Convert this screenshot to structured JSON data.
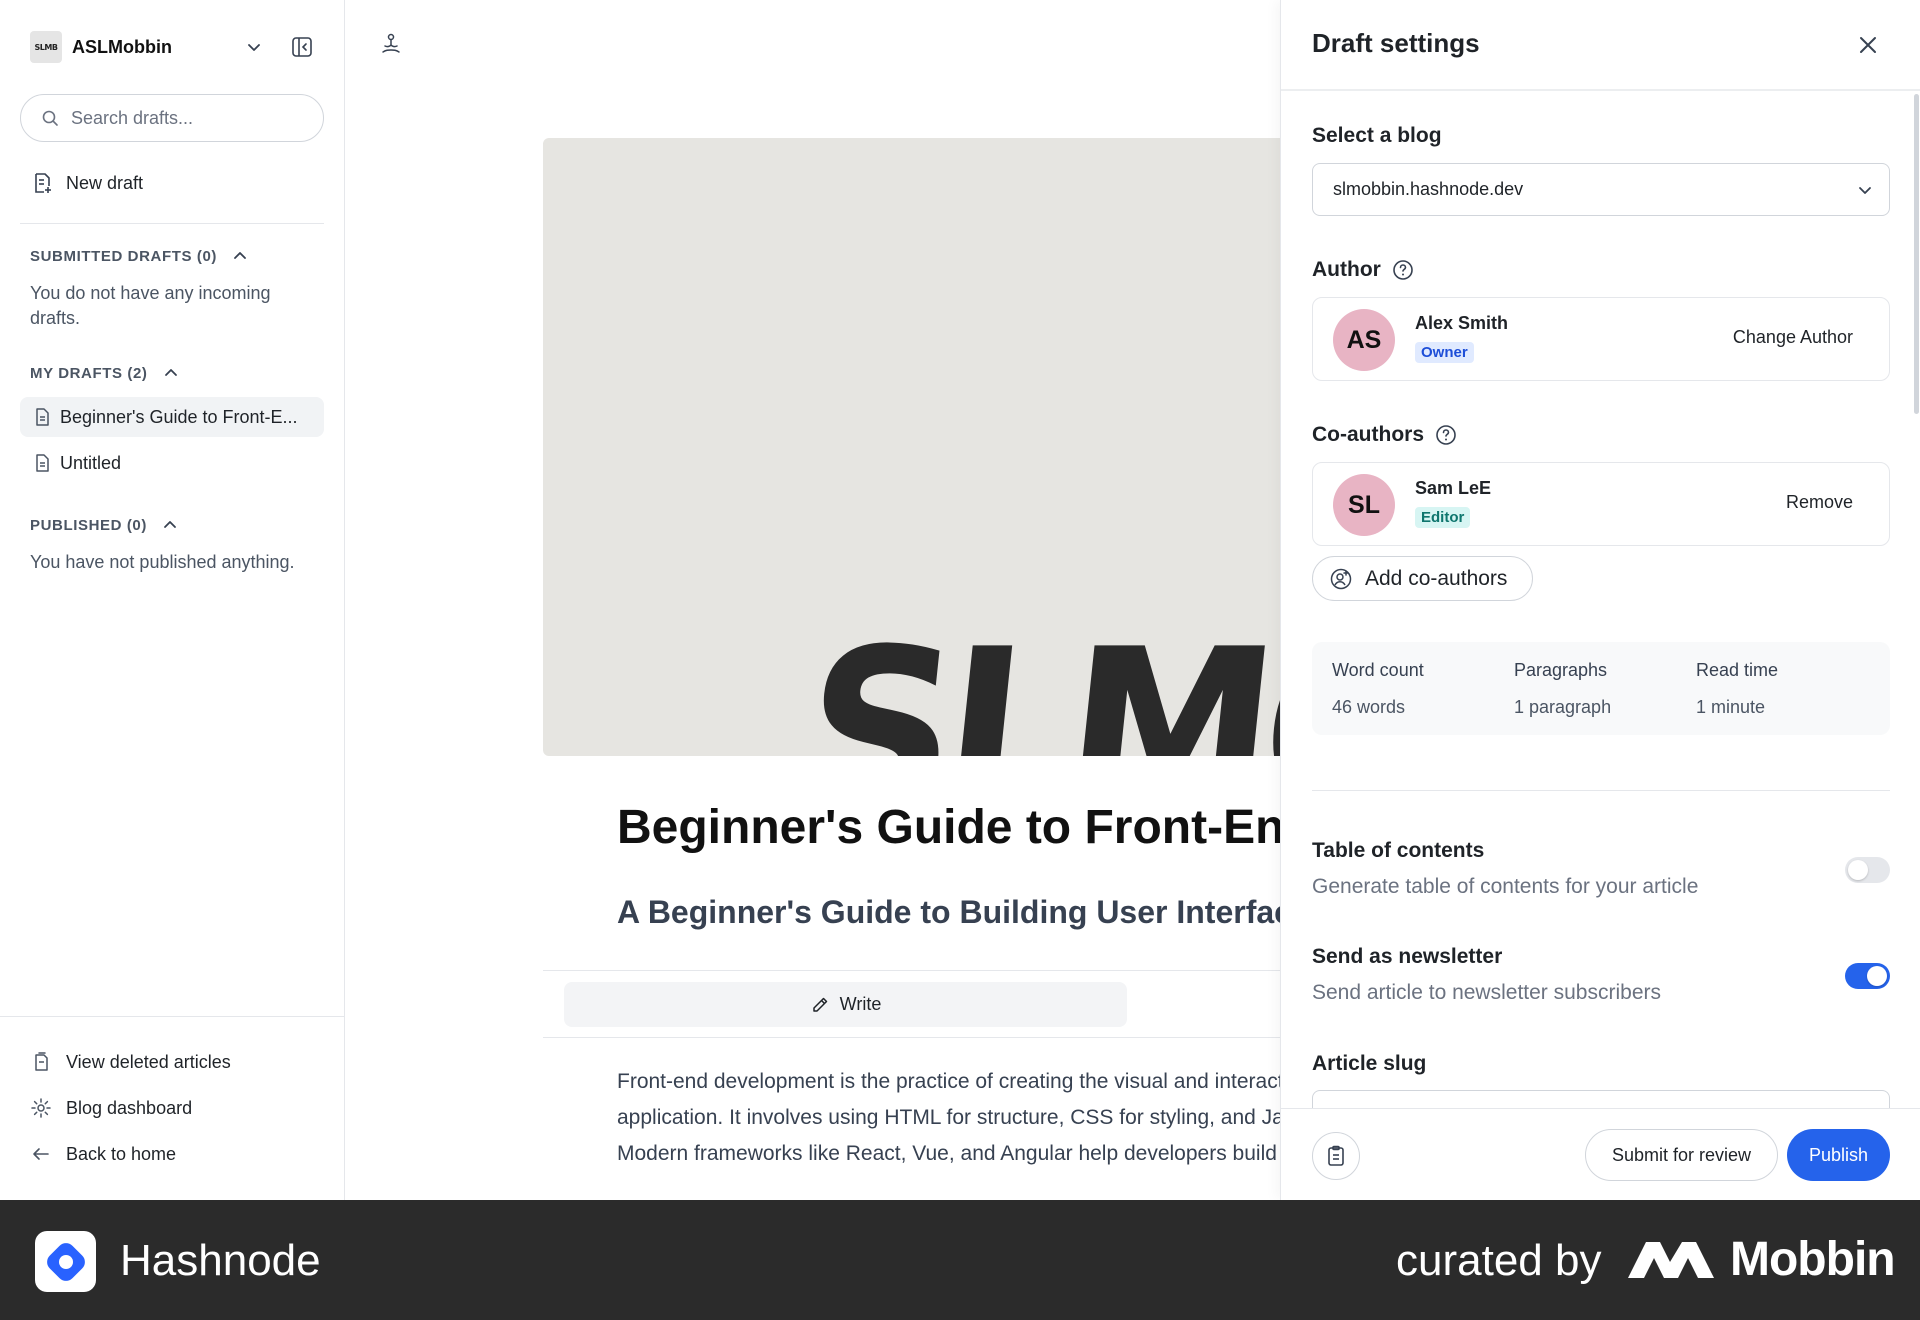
{
  "sidebar": {
    "workspace": {
      "logo_text": "SLMB",
      "name": "ASLMobbin"
    },
    "search": {
      "placeholder": "Search drafts..."
    },
    "new_draft_label": "New draft",
    "submitted": {
      "heading": "SUBMITTED DRAFTS (0)",
      "empty_text": "You do not have any incoming drafts."
    },
    "my_drafts": {
      "heading": "MY DRAFTS (2)",
      "items": [
        {
          "label": "Beginner's Guide to Front-E...",
          "active": true
        },
        {
          "label": "Untitled",
          "active": false
        }
      ]
    },
    "published": {
      "heading": "PUBLISHED (0)",
      "empty_text": "You have not published anything."
    },
    "footer_links": [
      {
        "label": "View deleted articles",
        "icon": "trash-doc-icon"
      },
      {
        "label": "Blog dashboard",
        "icon": "gear-icon"
      },
      {
        "label": "Back to home",
        "icon": "arrow-left-icon"
      }
    ]
  },
  "editor": {
    "cover_text": "SLMO",
    "title": "Beginner's Guide to Front-End",
    "subtitle": "A Beginner's Guide to Building User Interfaces",
    "mode": {
      "write_label": "Write"
    },
    "body": "Front-end development is the practice of creating the visual and interactive parts of a website or application. It involves using HTML for structure, CSS for styling, and JavaScript for interactivity. Modern frameworks like React, Vue, and Angular help developers build dynamic"
  },
  "panel": {
    "title": "Draft settings",
    "blog": {
      "label": "Select a blog",
      "value": "slmobbin.hashnode.dev"
    },
    "author": {
      "label": "Author",
      "initials": "AS",
      "name": "Alex Smith",
      "role": "Owner",
      "action": "Change Author"
    },
    "coauthors": {
      "label": "Co-authors",
      "items": [
        {
          "initials": "SL",
          "name": "Sam LeE",
          "role": "Editor",
          "action": "Remove"
        }
      ],
      "add_label": "Add co-authors"
    },
    "stats": [
      {
        "label": "Word count",
        "value": "46 words"
      },
      {
        "label": "Paragraphs",
        "value": "1 paragraph"
      },
      {
        "label": "Read time",
        "value": "1 minute"
      }
    ],
    "options": [
      {
        "title": "Table of contents",
        "desc": "Generate table of contents for your article",
        "enabled": false
      },
      {
        "title": "Send as newsletter",
        "desc": "Send article to newsletter subscribers",
        "enabled": true
      }
    ],
    "slug_label": "Article slug",
    "footer": {
      "review_label": "Submit for review",
      "publish_label": "Publish"
    }
  },
  "brandbar": {
    "app_name": "Hashnode",
    "curated_label": "curated by",
    "curator_name": "Mobbin"
  },
  "colors": {
    "accent": "#2563eb",
    "brandbar": "#2b2b2b",
    "avatar": "#e8b4c4"
  }
}
